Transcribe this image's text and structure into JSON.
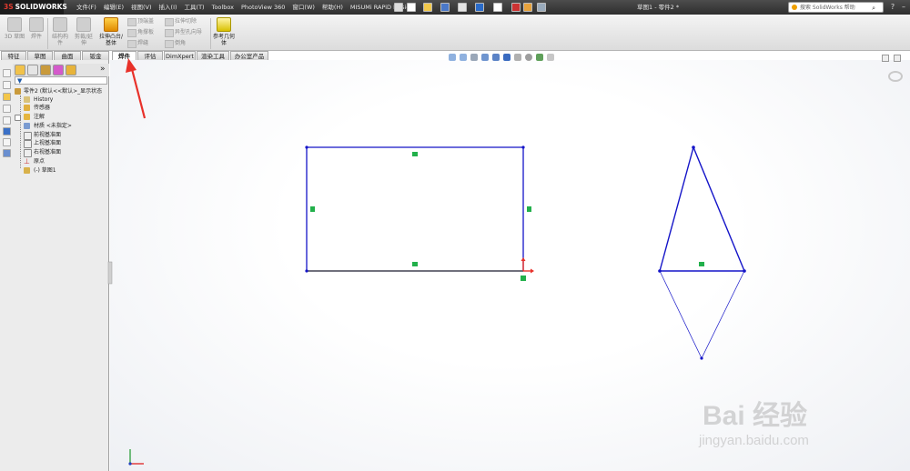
{
  "app": {
    "logo": "SOLIDWORKS",
    "window_title": "草图1 - 零件2 *"
  },
  "menu": [
    "文件(F)",
    "编辑(E)",
    "视图(V)",
    "插入(I)",
    "工具(T)",
    "Toolbox",
    "PhotoView 360",
    "窗口(W)",
    "帮助(H)",
    "MISUMi RAPiD Design"
  ],
  "help_search": {
    "placeholder": "搜索 SolidWorks 帮助"
  },
  "command_manager": {
    "large": [
      "3D 草图",
      "焊件",
      "结构构件",
      "剪裁/延伸",
      "拉伸凸台/基体"
    ],
    "small_col1": [
      "顶端盖",
      "角撑板",
      "焊缝"
    ],
    "small_col2": [
      "拉伸切除",
      "异型孔向导",
      "倒角"
    ],
    "ref_geom": "参考几何体"
  },
  "tabs": [
    "特征",
    "草图",
    "曲面",
    "钣金",
    "焊件",
    "评估",
    "DimXpert",
    "渲染工具",
    "办公室产品"
  ],
  "selected_tab": "焊件",
  "feature_tree": {
    "root": "零件2 (默认<<默认>_显示状态",
    "items": [
      "History",
      "传感器",
      "注解",
      "材质 <未指定>",
      "前视基准面",
      "上视基准面",
      "右视基准面",
      "原点"
    ],
    "sketch": "(-) 草图1"
  },
  "colors": {
    "sketch_line": "#1414c8",
    "relation": "#22b04b",
    "annotation_arrow": "#e8312a"
  },
  "watermark": {
    "brand": "Bai 经验",
    "url": "jingyan.baidu.com"
  }
}
